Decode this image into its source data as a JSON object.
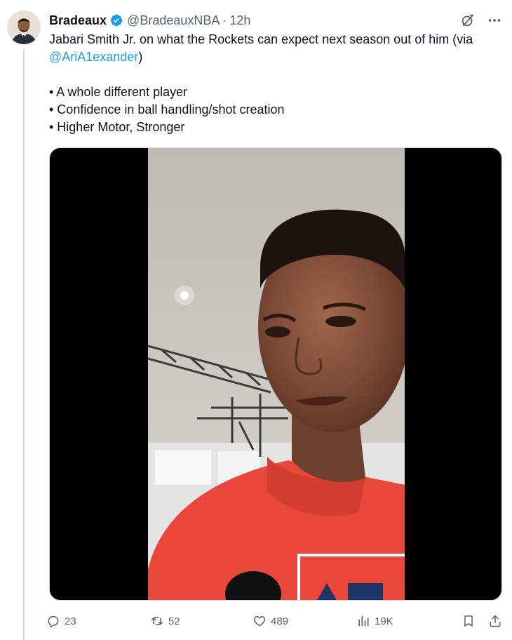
{
  "tweet": {
    "author_name": "Bradeaux",
    "author_handle": "@BradeauxNBA",
    "separator": "·",
    "time": "12h",
    "text_line1": "Jabari Smith Jr. on what the Rockets can expect next season out of him (via",
    "mention": "@AriA1exander",
    "mention_suffix": ")",
    "bullets": [
      "• A whole different player",
      "• Confidence in ball handling/shot creation",
      "• Higher Motor, Stronger"
    ]
  },
  "actions": {
    "replies": "23",
    "retweets": "52",
    "likes": "489",
    "views": "19K"
  },
  "icons": {
    "verified": "verified-badge-icon",
    "grok": "grok-icon",
    "more": "more-icon",
    "reply": "reply-icon",
    "retweet": "retweet-icon",
    "like": "like-icon",
    "views": "views-icon",
    "bookmark": "bookmark-icon",
    "share": "share-icon"
  },
  "colors": {
    "accent": "#1d9bf0",
    "text": "#0f1419",
    "muted": "#536471",
    "shirt": "#e8473a"
  }
}
